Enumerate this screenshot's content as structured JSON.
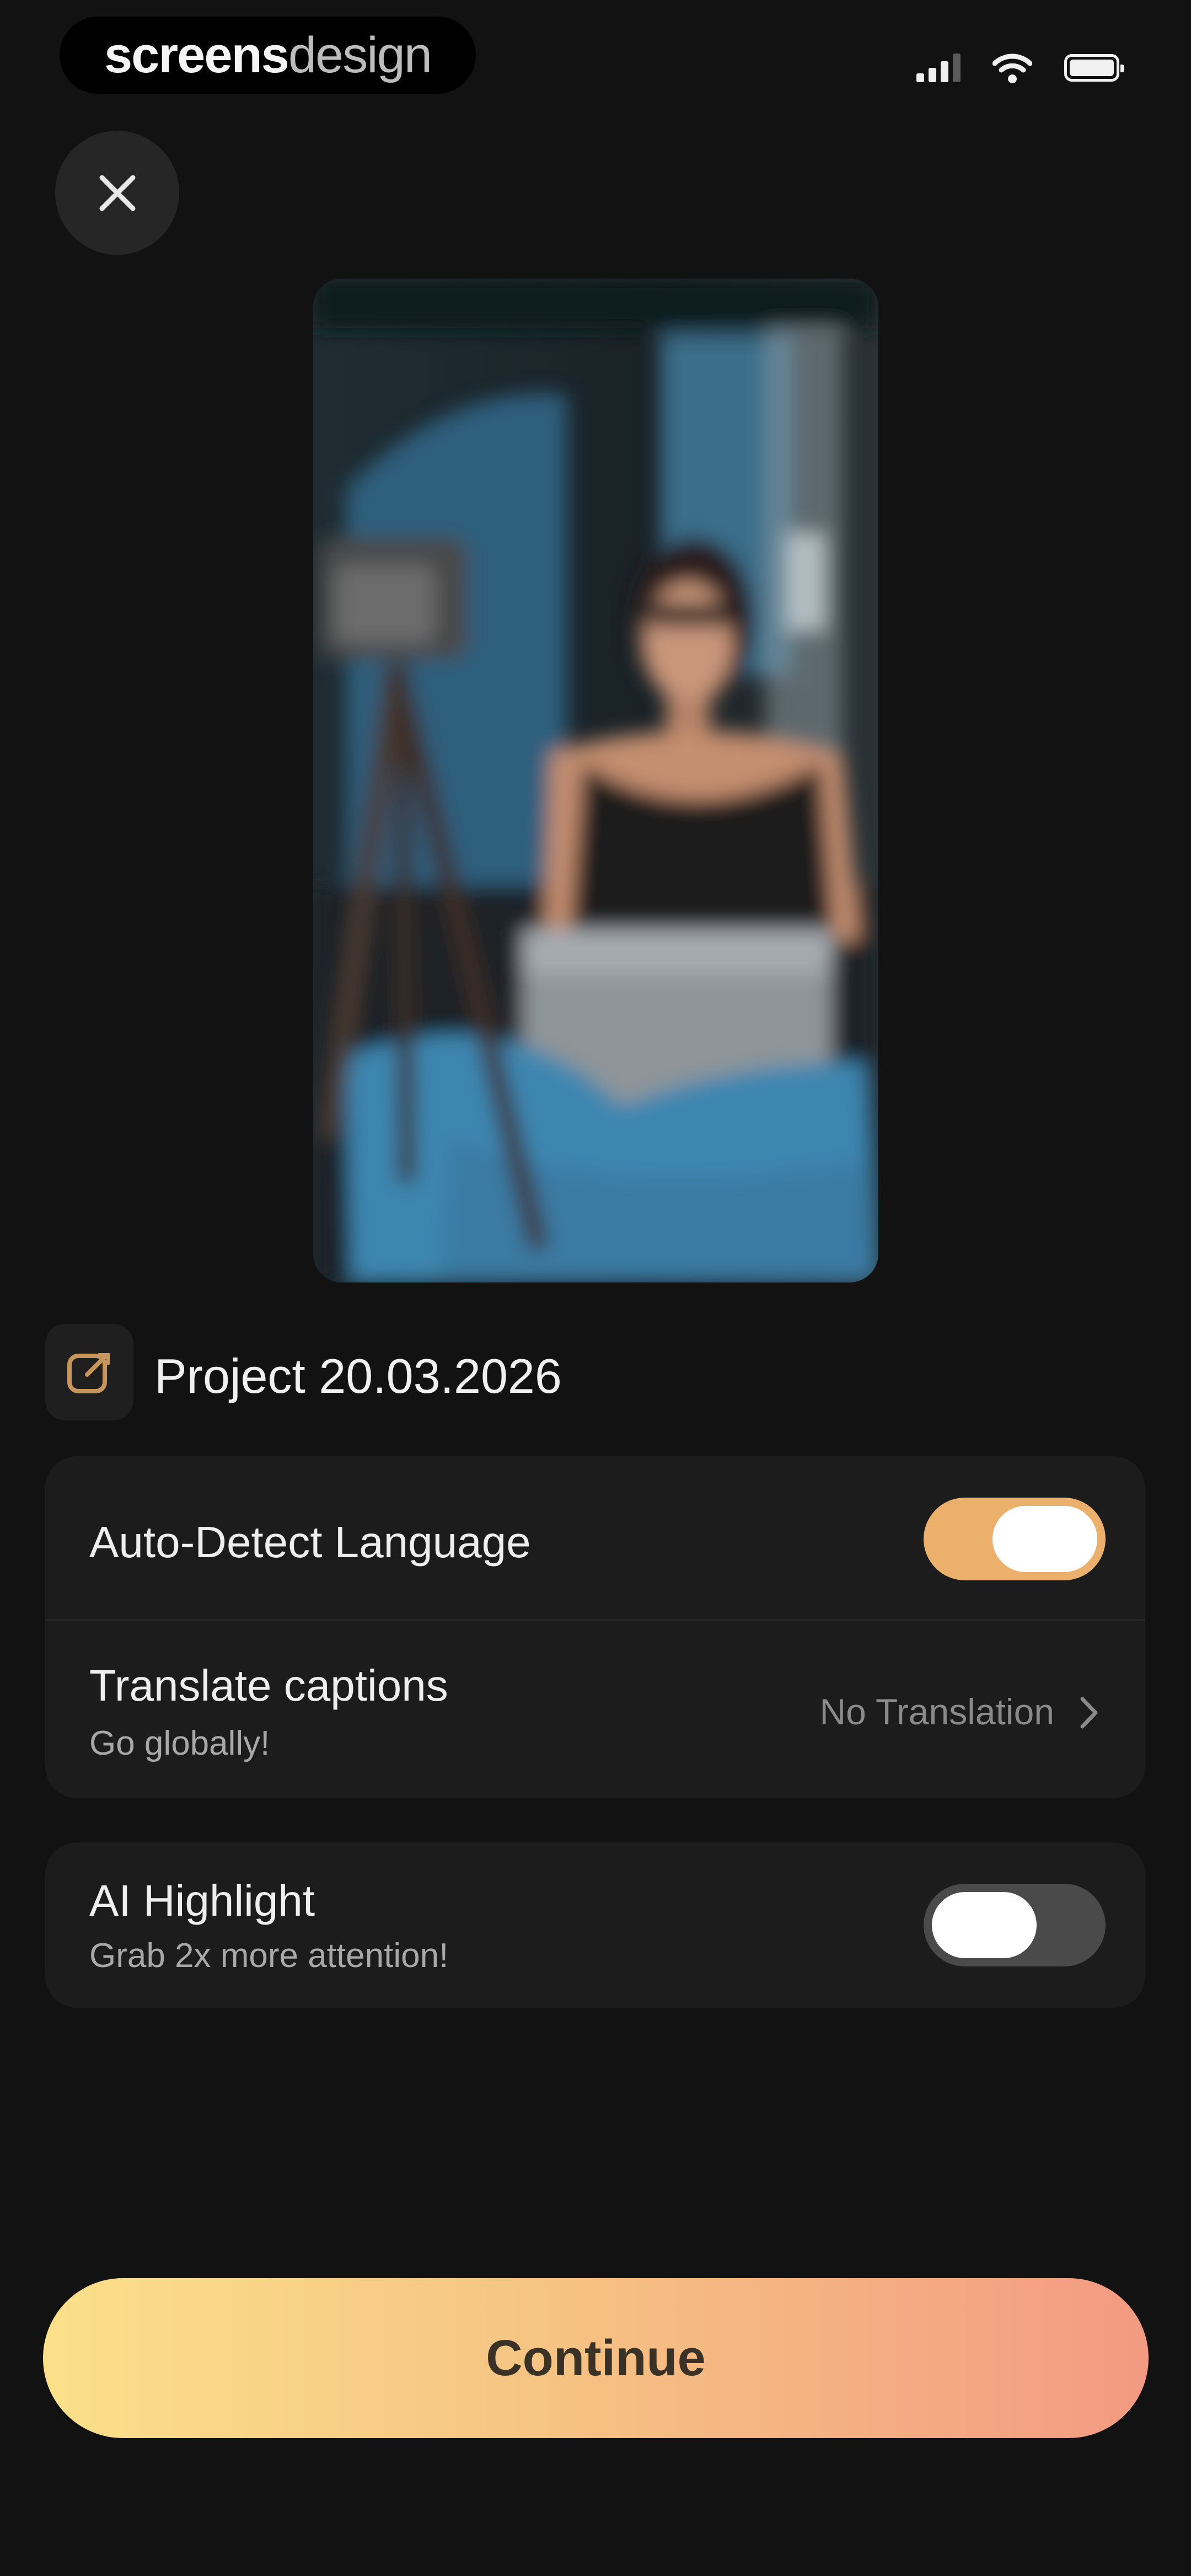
{
  "status_bar": {
    "brand_part1": "screens",
    "brand_part2": "design"
  },
  "header": {
    "close_icon": "close-icon"
  },
  "project": {
    "title": "Project 20.03.2026",
    "icon": "edit-icon"
  },
  "settings": {
    "auto_detect": {
      "label": "Auto-Detect Language",
      "enabled": true
    },
    "translate": {
      "label": "Translate captions",
      "sublabel": "Go globally!",
      "value": "No Translation"
    },
    "ai_highlight": {
      "label": "AI Highlight",
      "sublabel": "Grab 2x more attention!",
      "enabled": false
    }
  },
  "footer": {
    "continue_label": "Continue"
  },
  "colors": {
    "background": "#121212",
    "card": "#1c1c1c",
    "accent": "#ebb06b",
    "gradient_start": "#fbe08a",
    "gradient_end": "#f39a82"
  }
}
